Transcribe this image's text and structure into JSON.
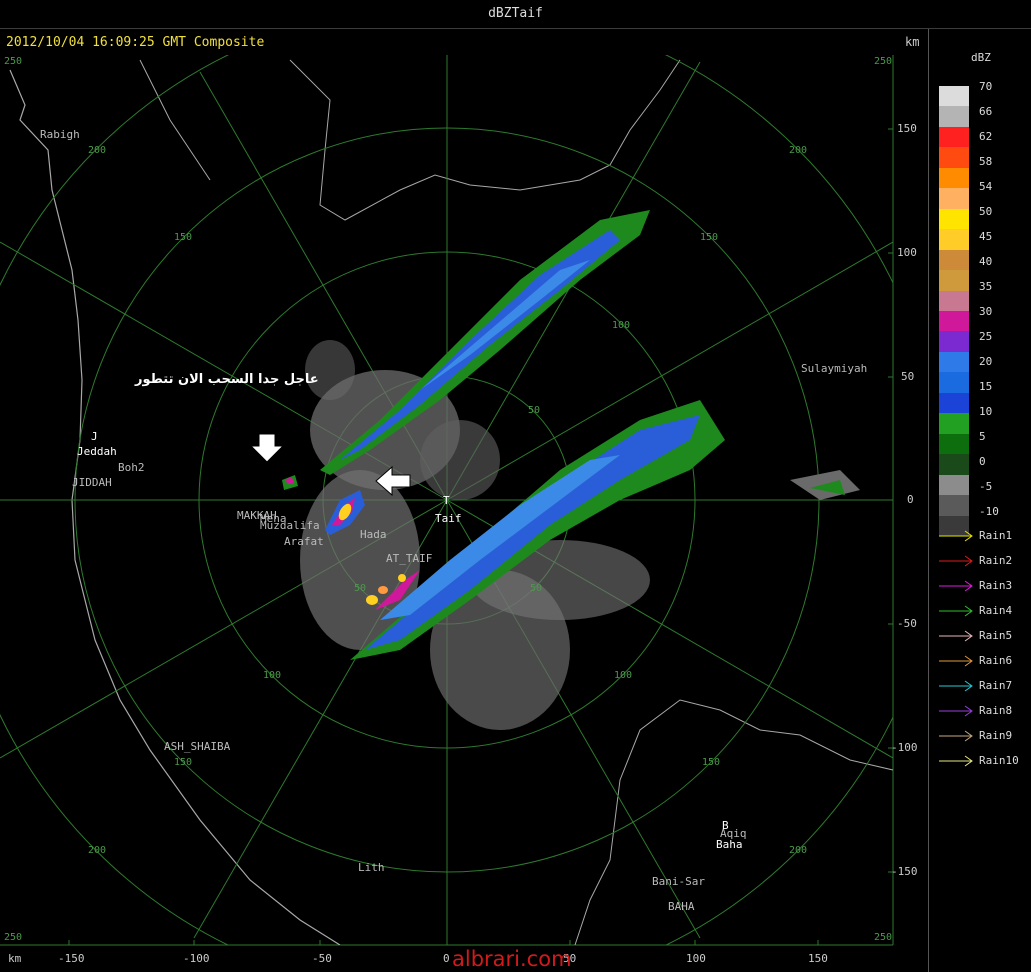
{
  "window": {
    "title": "dBZTaif"
  },
  "header": {
    "timestamp": "2012/10/04 16:09:25 GMT Composite",
    "km_label_top": "km",
    "km_label_bottom": "km"
  },
  "annotation": {
    "arabic_text": "عاجل جدا السحب الان تتطور"
  },
  "watermark": "albrari.com",
  "legend": {
    "title": "dBZ",
    "values": [
      "70",
      "66",
      "62",
      "58",
      "54",
      "50",
      "45",
      "40",
      "35",
      "30",
      "25",
      "20",
      "15",
      "10",
      "5",
      "0",
      "-5",
      "-10"
    ],
    "colors": [
      "#dcdcdc",
      "#b4b4b4",
      "#ff2020",
      "#ff4a10",
      "#ff8c00",
      "#ffb060",
      "#ffe400",
      "#ffcc28",
      "#cd8b3a",
      "#cf9a3c",
      "#c87890",
      "#d0189a",
      "#7a2ad0",
      "#2e7ae8",
      "#1a6ae0",
      "#1c43d8",
      "#21a021",
      "#0d6e0d",
      "#1a4a1a",
      "#8c8c8c",
      "#5a5a5a",
      "#3a3a3a"
    ],
    "rain_items": [
      {
        "label": "Rain1",
        "color": "#e6e600"
      },
      {
        "label": "Rain2",
        "color": "#e01c1c"
      },
      {
        "label": "Rain3",
        "color": "#e01ce0"
      },
      {
        "label": "Rain4",
        "color": "#30c030"
      },
      {
        "label": "Rain5",
        "color": "#e8b8b8"
      },
      {
        "label": "Rain6",
        "color": "#e09a3a"
      },
      {
        "label": "Rain7",
        "color": "#28c8d8"
      },
      {
        "label": "Rain8",
        "color": "#9a40e0"
      },
      {
        "label": "Rain9",
        "color": "#c8a880"
      },
      {
        "label": "Rain10",
        "color": "#e8e880"
      }
    ]
  },
  "axes": {
    "x_ticks": [
      "-150",
      "-100",
      "-50",
      "0",
      "50",
      "100",
      "150"
    ],
    "y_ticks": [
      "150",
      "100",
      "50",
      "0",
      "-50",
      "-100",
      "-150"
    ],
    "corner_labels": [
      "250",
      "250",
      "250",
      "250"
    ],
    "ring_labels": [
      "50",
      "100",
      "150",
      "200"
    ]
  },
  "places": {
    "rabigh": "Rabigh",
    "jeddah_marker": "J",
    "jeddah": "Jeddah",
    "boh2": "Boh2",
    "jiddah": "JIDDAH",
    "makkah": "MAKKAH",
    "mena": "Mena",
    "muzdalifa": "Muzdalifa",
    "arafat": "Arafat",
    "hada": "Hada",
    "at_taif": "AT_TAIF",
    "taif_marker": "T",
    "taif": "Taif",
    "sulaymiyah": "Sulaymiyah",
    "ash_shaiba": "ASH_SHAIBA",
    "lith": "Lith",
    "baha_marker": "B",
    "aqiq": "Aqiq",
    "baha": "Baha",
    "bani_sar": "Bani-Sar",
    "baha_upper": "BAHA"
  }
}
